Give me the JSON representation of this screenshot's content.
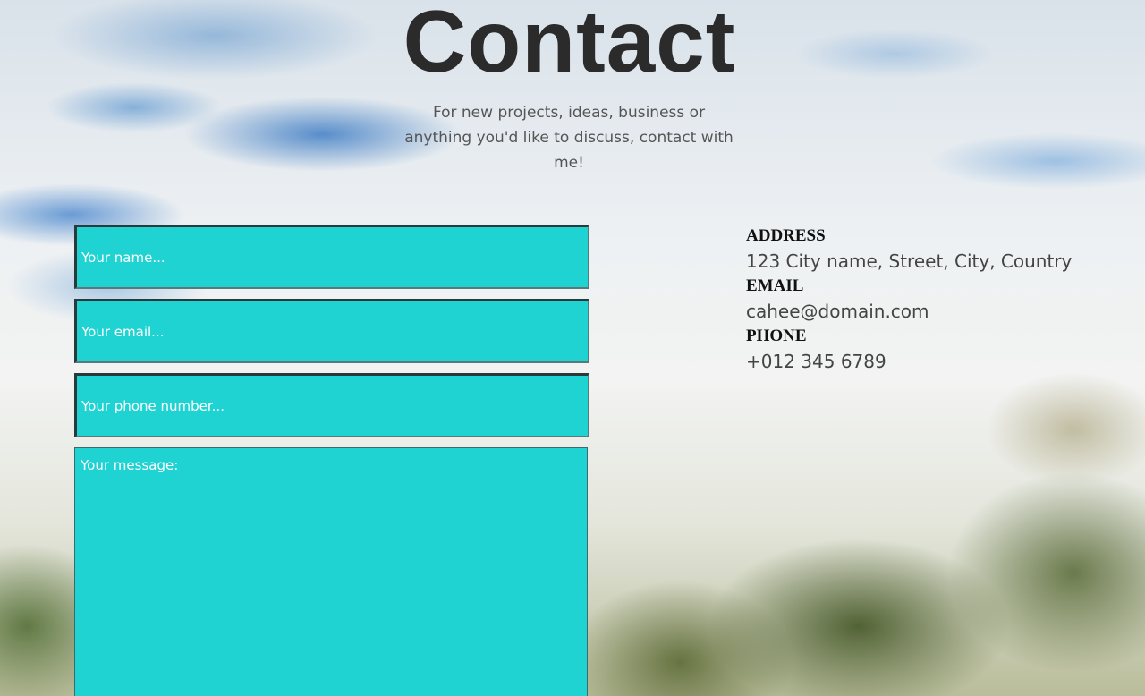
{
  "header": {
    "title": "Contact",
    "intro": "For new projects, ideas, business or anything you'd like to discuss, contact with me!"
  },
  "form": {
    "name_placeholder": "Your name...",
    "email_placeholder": "Your email...",
    "phone_placeholder": "Your phone number...",
    "message_placeholder": "Your message:",
    "field_color": "#1fd3d3"
  },
  "contact_info": {
    "address_label": "ADDRESS",
    "address_value": "123 City name, Street, City, Country",
    "email_label": "EMAIL",
    "email_value": "cahee@domain.com",
    "phone_label": "PHONE",
    "phone_value": "+012 345 6789"
  }
}
